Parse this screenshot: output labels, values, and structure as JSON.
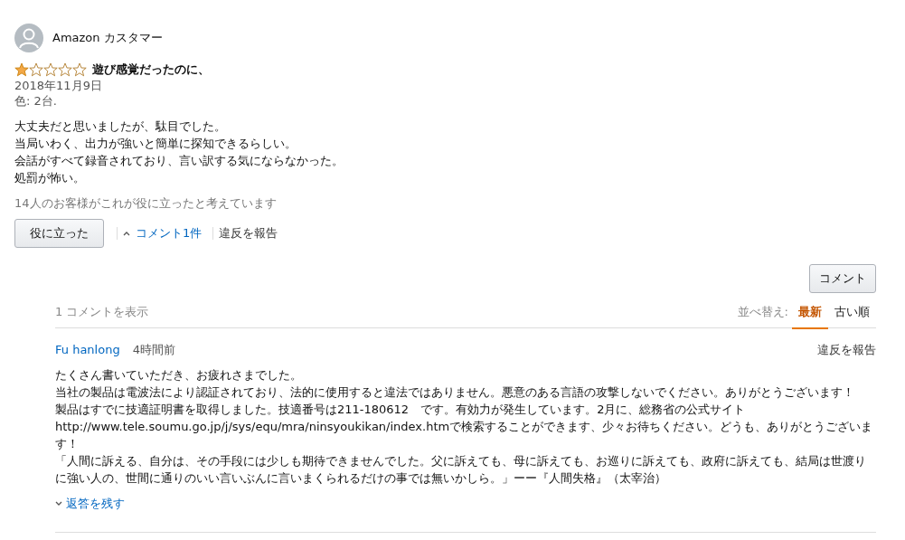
{
  "review": {
    "author": "Amazon カスタマー",
    "stars": 1,
    "title": "遊び感覚だったのに、",
    "date": "2018年11月9日",
    "variant": "色: 2台.",
    "body": [
      "大丈夫だと思いましたが、駄目でした。",
      "当局いわく、出力が強いと簡単に探知できるらしい。",
      "会話がすべて録音されており、言い訳する気にならなかった。",
      "処罰が怖い。"
    ],
    "helpful_count": "14人のお客様がこれが役に立ったと考えています",
    "helpful_button": "役に立った",
    "comments_link": "コメント1件",
    "report_link": "違反を報告"
  },
  "comment_button": "コメント",
  "comments": {
    "count_label": "1 コメントを表示",
    "sort_label": "並べ替え:",
    "sort_options": [
      {
        "label": "最新",
        "selected": true
      },
      {
        "label": "古い順",
        "selected": false
      }
    ],
    "items": [
      {
        "author": "Fu hanlong",
        "time": "4時間前",
        "report_link": "違反を報告",
        "body": [
          "たくさん書いていただき、お疲れさまでした。",
          "当社の製品は電波法により認証されており、法的に使用すると違法ではありません。悪意のある言語の攻撃しないでください。ありがとうございます！",
          "製品はすでに技適証明書を取得しました。技適番号は211-180612　です。有効力が発生しています。2月に、総務省の公式サイト",
          "http://www.tele.soumu.go.jp/j/sys/equ/mra/ninsyoukikan/index.htmで検索することができます、少々お待ちください。どうも、ありがとうございます！",
          "「人間に訴える、自分は、その手段には少しも期待できませんでした。父に訴えても、母に訴えても、お巡りに訴えても、政府に訴えても、結局は世渡りに強い人の、世間に通りのいい言いぶんに言いまくられるだけの事では無いかしら。」ーー『人間失格』（太宰治）"
        ],
        "reply_link": "返答を残す"
      }
    ]
  }
}
